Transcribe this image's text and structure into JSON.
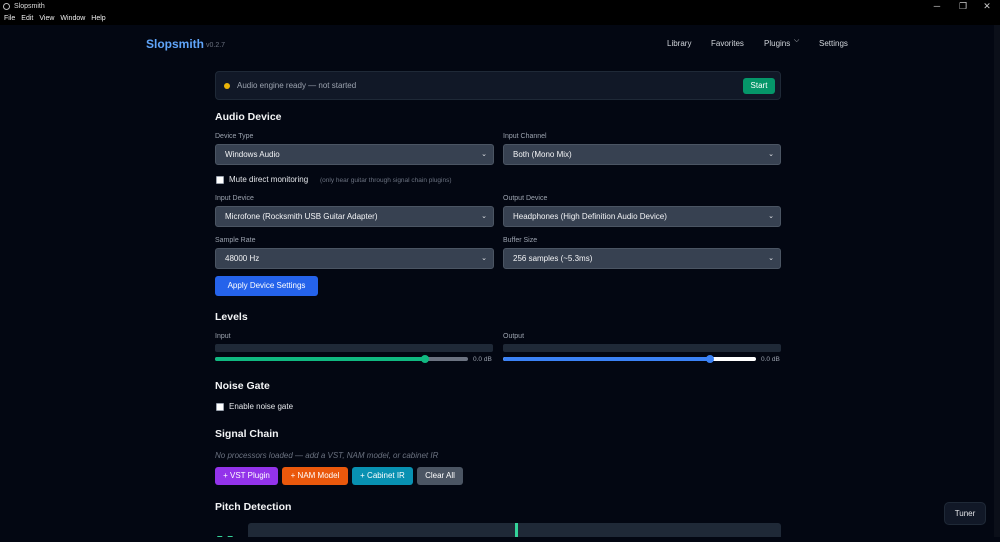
{
  "window": {
    "title": "Slopsmith",
    "minimize": "─",
    "restore": "❐",
    "close": "✕"
  },
  "menu": [
    "File",
    "Edit",
    "View",
    "Window",
    "Help"
  ],
  "nav": {
    "brand": "Slopsmith",
    "version": "v0.2.7",
    "links": [
      "Library",
      "Favorites",
      "Plugins",
      "Settings"
    ],
    "plugins_chevron": "⌵"
  },
  "status": {
    "text": "Audio engine ready — not started",
    "button": "Start",
    "dot_color": "#eab308"
  },
  "audio_device": {
    "heading": "Audio Device",
    "device_type_label": "Device Type",
    "device_type": "Windows Audio",
    "input_channel_label": "Input Channel",
    "input_channel": "Both (Mono Mix)",
    "mute_label": "Mute direct monitoring",
    "mute_hint": "(only hear guitar through signal chain plugins)",
    "input_device_label": "Input Device",
    "input_device": "Microfone (Rocksmith USB Guitar Adapter)",
    "output_device_label": "Output Device",
    "output_device": "Headphones (High Definition Audio Device)",
    "sample_rate_label": "Sample Rate",
    "sample_rate": "48000 Hz",
    "buffer_size_label": "Buffer Size",
    "buffer_size": "256 samples (~5.3ms)",
    "apply_button": "Apply Device Settings",
    "chevron": "⌄"
  },
  "levels": {
    "heading": "Levels",
    "input_label": "Input",
    "input_db": "0.0 dB",
    "input_level": 0.83,
    "input_color": "#10b981",
    "output_label": "Output",
    "output_db": "0.0 dB",
    "output_level": 0.82,
    "output_color": "#3b82f6"
  },
  "noise_gate": {
    "heading": "Noise Gate",
    "enable_label": "Enable noise gate"
  },
  "signal_chain": {
    "heading": "Signal Chain",
    "empty_text": "No processors loaded — add a VST, NAM model, or cabinet IR",
    "buttons": [
      "+ VST Plugin",
      "+ NAM Model",
      "+ Cabinet IR",
      "Clear All"
    ]
  },
  "pitch": {
    "heading": "Pitch Detection",
    "note": "– –"
  },
  "tuner": {
    "label": "Tuner"
  }
}
